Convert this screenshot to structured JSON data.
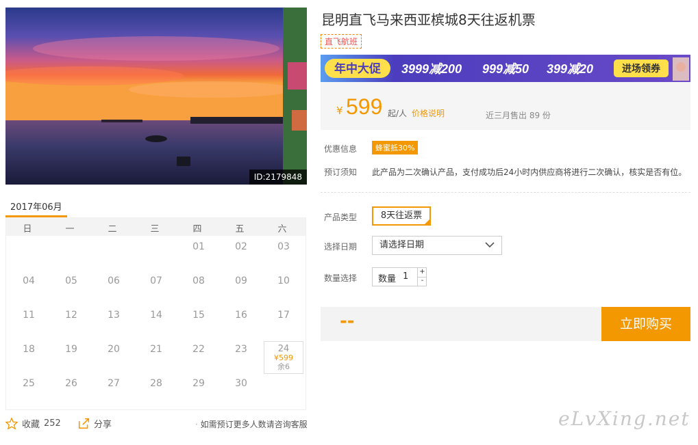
{
  "photo": {
    "id_label": "ID:2179848"
  },
  "product": {
    "title": "昆明直飞马来西亚槟城8天往返机票",
    "tag": "直飞航班"
  },
  "banner": {
    "headline": "年中大促",
    "offers": [
      "3999减200",
      "999减50",
      "399减20"
    ],
    "cta": "进场领券"
  },
  "price": {
    "currency": "¥",
    "value": "599",
    "unit": "起/人",
    "explain_link": "价格说明",
    "sold": "近三月售出 89 份"
  },
  "info": {
    "discount_label": "优惠信息",
    "discount_badge": "蜂蜜抵30%",
    "notice_label": "预订须知",
    "notice_text": "此产品为二次确认产品，支付成功后24小时内供应商将进行二次确认，核实是否有位。"
  },
  "options": {
    "type_label": "产品类型",
    "type_value": "8天往返票",
    "date_label": "选择日期",
    "date_placeholder": "请选择日期",
    "qty_label": "数量选择",
    "qty_prefix": "数量",
    "qty_value": "1",
    "plus": "+",
    "minus": "-"
  },
  "purchase": {
    "total": "--",
    "buy_button": "立即购买"
  },
  "calendar": {
    "month": "2017年06月",
    "weekdays": [
      "日",
      "一",
      "二",
      "三",
      "四",
      "五",
      "六"
    ],
    "days": [
      "01",
      "02",
      "03",
      "04",
      "05",
      "06",
      "07",
      "08",
      "09",
      "10",
      "11",
      "12",
      "13",
      "14",
      "15",
      "16",
      "17",
      "18",
      "19",
      "20",
      "21",
      "22",
      "23",
      "24",
      "25",
      "26",
      "27",
      "28",
      "29",
      "30"
    ],
    "first_weekday_index": 4,
    "selected": {
      "day": "24",
      "price": "¥599",
      "remain": "余6"
    }
  },
  "footer": {
    "favorite_label": "收藏",
    "favorite_count": "252",
    "share_label": "分享",
    "consult_text": "如需预订更多人数请咨询客服"
  },
  "watermark": "eLvXing.net",
  "colors": {
    "accent": "#f39800",
    "tag_text": "#e55555",
    "banner_bg": "#4b3dbd"
  }
}
